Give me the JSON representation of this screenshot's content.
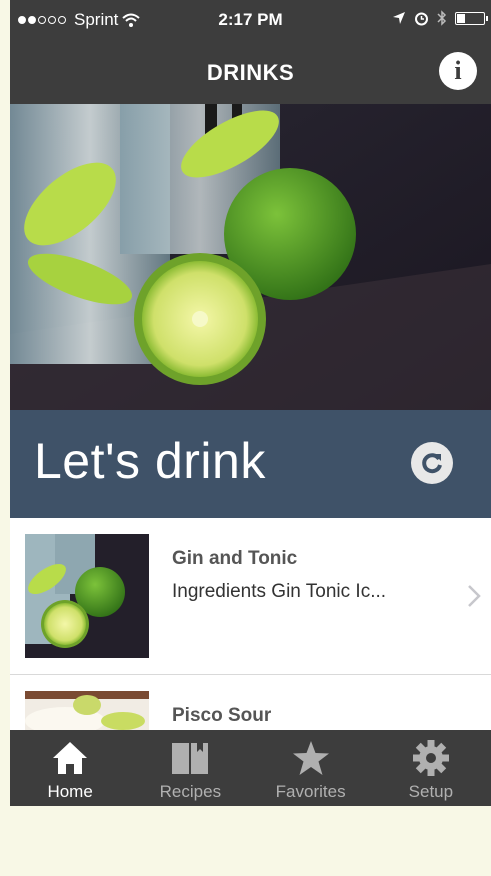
{
  "status_bar": {
    "carrier": "Sprint",
    "time": "2:17 PM"
  },
  "nav": {
    "title": "DRINKS",
    "info_label": "i"
  },
  "banner": {
    "title": "Let's drink"
  },
  "drinks": [
    {
      "name": "Gin and Tonic",
      "description": "Ingredients Gin Tonic Ic..."
    },
    {
      "name": "Pisco Sour",
      "description": ""
    }
  ],
  "tabs": [
    {
      "label": "Home",
      "icon": "house-icon",
      "active": true
    },
    {
      "label": "Recipes",
      "icon": "book-icon",
      "active": false
    },
    {
      "label": "Favorites",
      "icon": "star-icon",
      "active": false
    },
    {
      "label": "Setup",
      "icon": "gear-icon",
      "active": false
    }
  ],
  "colors": {
    "bar_background": "#3d3d3d",
    "banner_background": "#3f5268",
    "page_background": "#f8f8e6"
  }
}
